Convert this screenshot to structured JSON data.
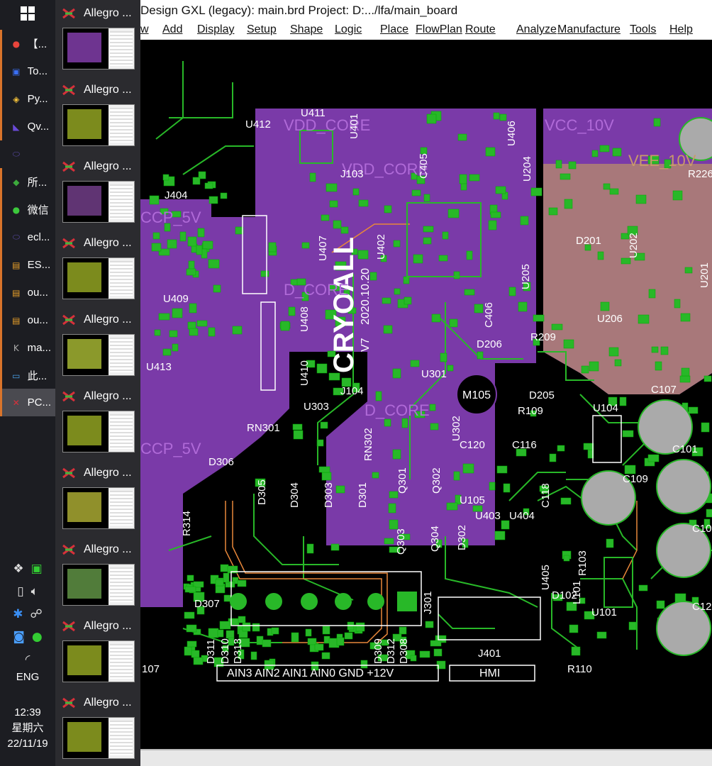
{
  "taskbar": {
    "items": [
      {
        "label": "【...",
        "icon": "chrome-icon"
      },
      {
        "label": "To...",
        "icon": "save-icon"
      },
      {
        "label": "Py...",
        "icon": "python-icon"
      },
      {
        "label": "Qv...",
        "icon": "qv-icon"
      },
      {
        "label": "",
        "icon": "eclipse-icon"
      },
      {
        "label": "所...",
        "icon": "evernote-icon"
      },
      {
        "label": "微信",
        "icon": "wechat-icon"
      },
      {
        "label": "ecl...",
        "icon": "eclipse-icon"
      },
      {
        "label": "ES...",
        "icon": "pdf-icon"
      },
      {
        "label": "ou...",
        "icon": "pdf-icon"
      },
      {
        "label": "ou...",
        "icon": "pdf-icon"
      },
      {
        "label": "ma...",
        "icon": "k-icon"
      },
      {
        "label": "此...",
        "icon": "computer-icon"
      },
      {
        "label": "PC...",
        "icon": "allegro-icon"
      }
    ],
    "language": "ENG",
    "time": "12:39",
    "weekday": "星期六",
    "date": "22/11/19"
  },
  "thumbnails": [
    {
      "title": "Allegro ...",
      "color": "#7a3aa0"
    },
    {
      "title": "Allegro ...",
      "color": "#8a9a20"
    },
    {
      "title": "Allegro ...",
      "color": "#6a3a80"
    },
    {
      "title": "Allegro ...",
      "color": "#8a9a20"
    },
    {
      "title": "Allegro ...",
      "color": "#9aaa30"
    },
    {
      "title": "Allegro ...",
      "color": "#8a9a20"
    },
    {
      "title": "Allegro ...",
      "color": "#a0a030"
    },
    {
      "title": "Allegro ...",
      "color": "#5a8a40"
    },
    {
      "title": "Allegro ...",
      "color": "#8a9a20"
    },
    {
      "title": "Allegro ...",
      "color": "#8a9a20"
    }
  ],
  "window": {
    "title": "Design GXL (legacy): main.brd  Project: D:.../lfa/main_board"
  },
  "menu": [
    "w",
    "Add",
    "Display",
    "Setup",
    "Shape",
    "Logic",
    "Place",
    "FlowPlan",
    "Route",
    "Analyze",
    "Manufacture",
    "Tools",
    "Help"
  ],
  "board": {
    "silk_text": {
      "logo": "CRYOALL",
      "version": "V7",
      "date": "2020.10.20",
      "connector_label": "AIN3 AIN2 AIN1 AIN0 GND +12V",
      "hmi_label": "HMI",
      "m105": "M105"
    },
    "plane_labels": [
      "VDD_CORE",
      "VDD_CORE",
      "VCC_10V",
      "VEE_10V",
      "CCP_5V",
      "CCP_5V",
      "D_CORE",
      "D_CORE"
    ],
    "refdes": [
      "U411",
      "U412",
      "U401",
      "U406",
      "J103",
      "C405",
      "U204",
      "R226",
      "J404",
      "U402",
      "U407",
      "U202",
      "D201",
      "U201",
      "U409",
      "U408",
      "U205",
      "U206",
      "R209",
      "D206",
      "C406",
      "U413",
      "U410",
      "J104",
      "U301",
      "D205",
      "M105",
      "R109",
      "C107",
      "U104",
      "U303",
      "RN301",
      "RN302",
      "U302",
      "C120",
      "C116",
      "C101",
      "D306",
      "D305",
      "D304",
      "D303",
      "D301",
      "Q301",
      "Q302",
      "C118",
      "C109",
      "R314",
      "U105",
      "U403",
      "U404",
      "D302",
      "Q303",
      "Q304",
      "R103",
      "C10",
      "U405",
      "L101",
      "D102",
      "D307",
      "J301",
      "U101",
      "C12",
      "D311",
      "D310",
      "D313",
      "D309",
      "D312",
      "D308",
      "J401",
      "R110",
      "107"
    ],
    "colors": {
      "plane_purple": "#7a3aa8",
      "plane_pink": "#a8787a",
      "trace_green": "#28b828",
      "silk_white": "#ffffff",
      "accent_orange": "#e8873a"
    }
  }
}
